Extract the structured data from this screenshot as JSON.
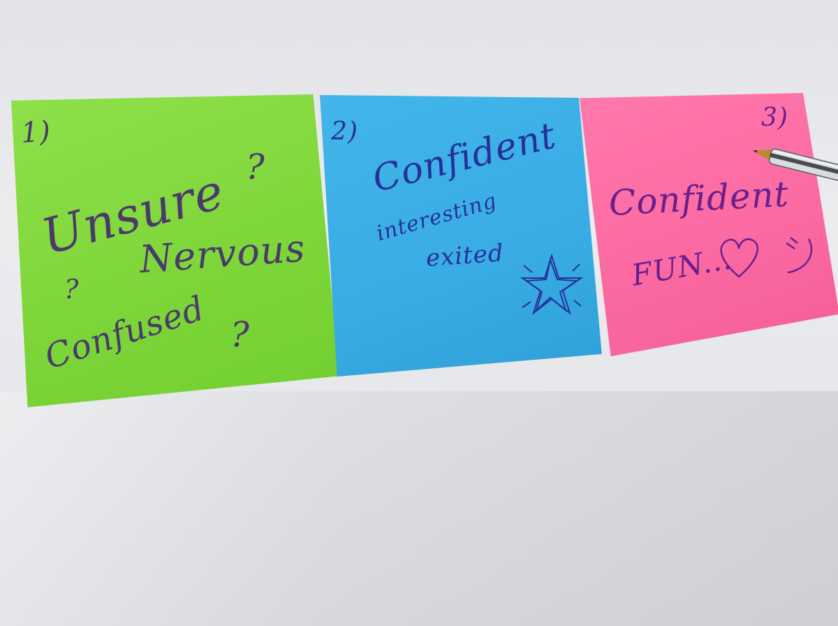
{
  "notes": {
    "green": {
      "number": "1)",
      "words": [
        "Unsure",
        "Nervous",
        "Confused"
      ],
      "marks": [
        "?",
        "?",
        "?"
      ],
      "color": "#7ed63a"
    },
    "blue": {
      "number": "2)",
      "words": [
        "Confident",
        "interesting",
        "exited"
      ],
      "color": "#38ace3"
    },
    "pink": {
      "number": "3)",
      "words": [
        "Confident",
        "FUN..."
      ],
      "color": "#fb6aa2"
    }
  },
  "ink_colors": {
    "green_note": "#4a3a6b",
    "blue_note": "#27309a",
    "pink_note": "#6a1f8e"
  },
  "icons": [
    "star-doodle-icon",
    "heart-doodle-icon",
    "smiley-doodle-icon",
    "pen-icon"
  ]
}
